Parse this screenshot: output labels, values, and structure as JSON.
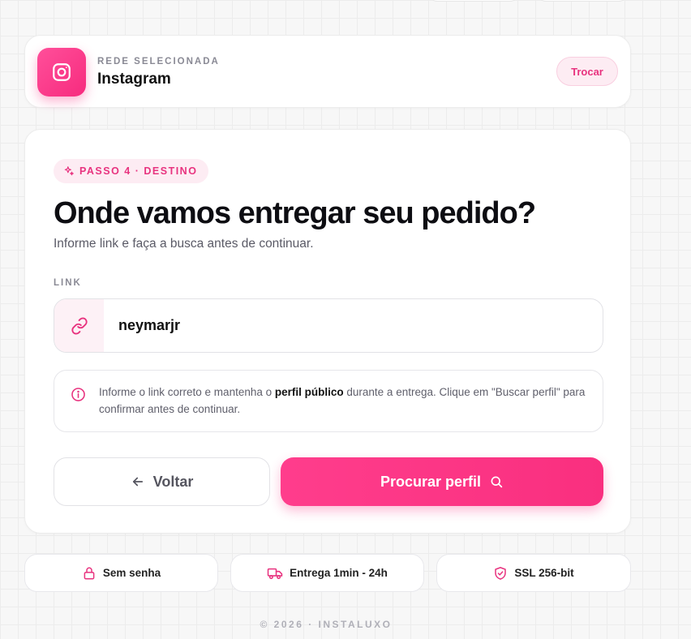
{
  "network": {
    "label": "REDE SELECIONADA",
    "name": "Instagram",
    "swap_label": "Trocar",
    "icon": "instagram-icon"
  },
  "step": {
    "badge": "PASSO 4 · DESTINO",
    "icon": "sparkles-icon"
  },
  "main": {
    "title": "Onde vamos entregar seu pedido?",
    "subtitle": "Informe link e faça a busca antes de continuar."
  },
  "link_field": {
    "label": "LINK",
    "value": "neymarjr",
    "icon": "link-icon"
  },
  "info": {
    "text_before": "Informe o link correto e mantenha o ",
    "text_bold": "perfil público",
    "text_after": " durante a entrega. Clique em \"Buscar perfil\" para confirmar antes de continuar.",
    "icon": "info-icon"
  },
  "buttons": {
    "back_label": "Voltar",
    "search_label": "Procurar perfil"
  },
  "badges": [
    {
      "label": "Sem senha",
      "icon": "lock-icon"
    },
    {
      "label": "Entrega 1min - 24h",
      "icon": "truck-icon"
    },
    {
      "label": "SSL 256-bit",
      "icon": "shield-check-icon"
    }
  ],
  "footer": "© 2026 · INSTALUXO",
  "colors": {
    "accent": "#f72b7e",
    "accent_soft": "#fdecf3"
  }
}
